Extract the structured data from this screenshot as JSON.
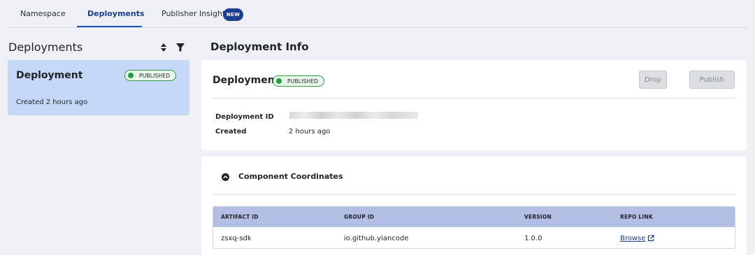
{
  "tabs": [
    {
      "label": "Namespace"
    },
    {
      "label": "Deployments",
      "active": true
    },
    {
      "label": "Publisher Insights",
      "badge": "NEW"
    }
  ],
  "left": {
    "title": "Deployments",
    "icons": [
      "sort-icon",
      "filter-icon"
    ],
    "card": {
      "title": "Deployment",
      "status": "PUBLISHED",
      "created": "Created 2 hours ago"
    }
  },
  "right": {
    "title": "Deployment Info",
    "deployment": {
      "title": "Deployment",
      "status": "PUBLISHED",
      "drop_label": "Drop",
      "publish_label": "Publish",
      "id_label": "Deployment ID",
      "created_label": "Created",
      "created_value": "2 hours ago"
    },
    "coordinates": {
      "title": "Component Coordinates",
      "columns": [
        "ARTIFACT ID",
        "GROUP ID",
        "VERSION",
        "REPO LINK"
      ],
      "rows": [
        {
          "artifact_id": "zsxq-sdk",
          "group_id": "io.github.yiancode",
          "version": "1.0.0",
          "repo_link": "Browse"
        }
      ]
    }
  },
  "colors": {
    "accent": "#1c3f8f",
    "selected_card": "#c5d8f7",
    "published": "#1f9e45",
    "table_header": "#b3bee5"
  }
}
